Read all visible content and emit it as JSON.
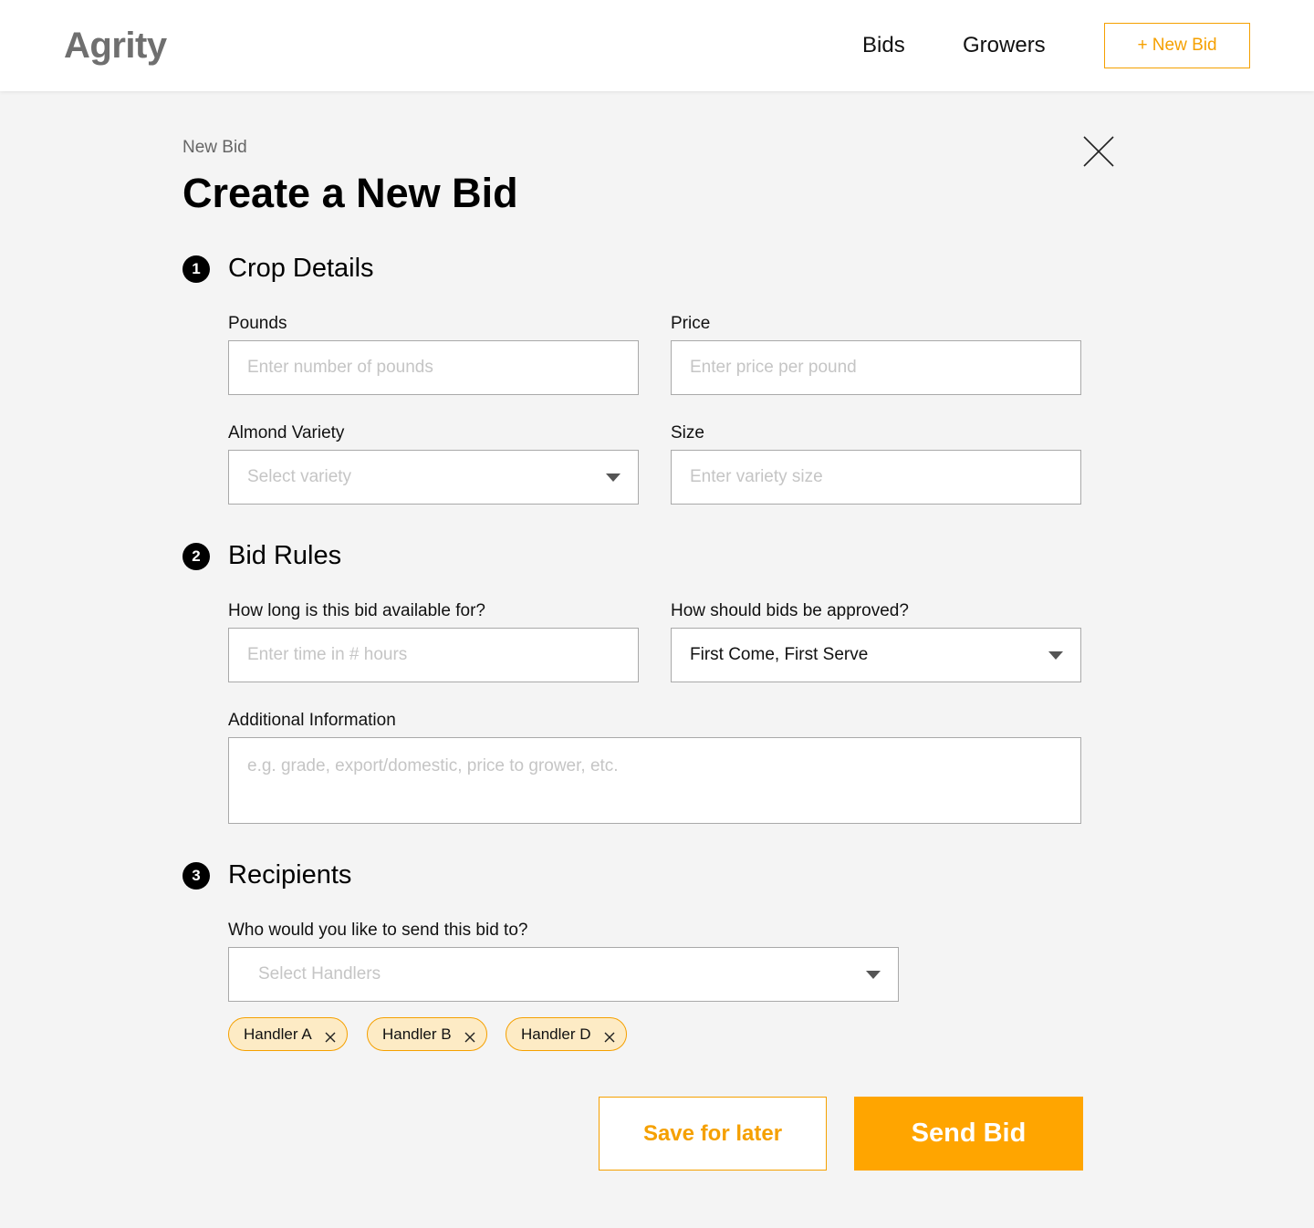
{
  "header": {
    "logo": "Agrity",
    "nav": {
      "bids": "Bids",
      "growers": "Growers"
    },
    "new_bid_button": "+ New Bid"
  },
  "page": {
    "breadcrumb": "New Bid",
    "title": "Create a New Bid"
  },
  "sections": {
    "crop": {
      "number": "1",
      "title": "Crop Details",
      "pounds_label": "Pounds",
      "pounds_placeholder": "Enter number of pounds",
      "price_label": "Price",
      "price_placeholder": "Enter price per pound",
      "variety_label": "Almond Variety",
      "variety_placeholder": "Select variety",
      "size_label": "Size",
      "size_placeholder": "Enter variety size"
    },
    "rules": {
      "number": "2",
      "title": "Bid Rules",
      "duration_label": "How long is this bid available for?",
      "duration_placeholder": "Enter time in # hours",
      "approval_label": "How should bids be approved?",
      "approval_value": "First Come, First Serve",
      "info_label": "Additional Information",
      "info_placeholder": "e.g. grade, export/domestic, price to grower, etc."
    },
    "recipients": {
      "number": "3",
      "title": "Recipients",
      "handlers_label": "Who would you like to send this bid to?",
      "handlers_placeholder": "Select Handlers",
      "chips": [
        "Handler A",
        "Handler B",
        "Handler D"
      ]
    }
  },
  "actions": {
    "save": "Save for later",
    "send": "Send Bid"
  },
  "colors": {
    "accent": "#ffa500",
    "chip_bg": "#fdebc5",
    "background": "#f4f4f4"
  }
}
